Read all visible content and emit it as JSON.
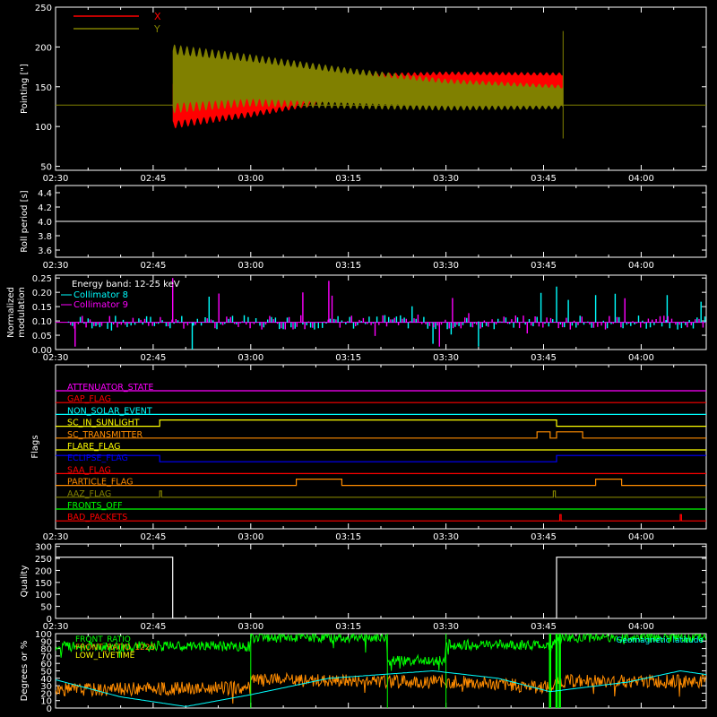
{
  "colors": {
    "background": "#000000",
    "axis": "#ffffff",
    "x_series": "#ff0000",
    "y_series": "#808000",
    "collimator_8": "#00ffff",
    "collimator_9": "#ff00ff",
    "front_ratio": "#00ff00",
    "orange": "#ff8c00",
    "blue": "#0000ff",
    "yellow": "#ffff00"
  },
  "chart_data": [
    {
      "id": "pointing",
      "type": "line",
      "ylabel": "Pointing [\"]",
      "ylim": [
        45,
        250
      ],
      "yticks": [
        50,
        100,
        150,
        200,
        250
      ],
      "xlim": [
        "02:30",
        "04:10"
      ],
      "xticks": [
        "02:30",
        "02:45",
        "03:00",
        "03:15",
        "03:30",
        "03:45",
        "04:00"
      ],
      "legend": {
        "position": "top-left",
        "entries": [
          "X",
          "Y"
        ]
      },
      "baseline": 127,
      "data_start": "02:48",
      "data_end": "03:48",
      "series": [
        {
          "name": "X",
          "color": "#ff0000",
          "center": [
            {
              "t": "02:48",
              "v": 130
            },
            {
              "t": "03:00",
              "v": 135
            },
            {
              "t": "03:15",
              "v": 150
            },
            {
              "t": "03:30",
              "v": 155
            },
            {
              "t": "03:48",
              "v": 155
            }
          ],
          "amplitude": [
            {
              "t": "02:48",
              "v": 28
            },
            {
              "t": "03:00",
              "v": 20
            },
            {
              "t": "03:15",
              "v": 14
            },
            {
              "t": "03:30",
              "v": 12
            },
            {
              "t": "03:48",
              "v": 11
            }
          ]
        },
        {
          "name": "Y",
          "color": "#808000",
          "center": [
            {
              "t": "02:48",
              "v": 160
            },
            {
              "t": "03:00",
              "v": 158
            },
            {
              "t": "03:15",
              "v": 148
            },
            {
              "t": "03:30",
              "v": 140
            },
            {
              "t": "03:48",
              "v": 137
            }
          ],
          "amplitude": [
            {
              "t": "02:48",
              "v": 37
            },
            {
              "t": "03:00",
              "v": 28
            },
            {
              "t": "03:15",
              "v": 22
            },
            {
              "t": "03:30",
              "v": 17
            },
            {
              "t": "03:48",
              "v": 13
            }
          ]
        }
      ]
    },
    {
      "id": "roll_period",
      "type": "line",
      "ylabel": "Roll period [s]",
      "ylim": [
        3.5,
        4.5
      ],
      "yticks": [
        "3.6",
        "3.8",
        "4.0",
        "4.2",
        "4.4"
      ],
      "xlim": [
        "02:30",
        "04:10"
      ],
      "xticks": [
        "02:30",
        "02:45",
        "03:00",
        "03:15",
        "03:30",
        "03:45",
        "04:00"
      ],
      "series": [
        {
          "name": "",
          "values": [
            {
              "t": "02:30",
              "v": 4.0
            },
            {
              "t": "04:10",
              "v": 4.0
            }
          ]
        }
      ]
    },
    {
      "id": "modulation",
      "type": "bar",
      "ylabel_lines": [
        "Normalized",
        "modulation"
      ],
      "ylim": [
        0,
        0.26
      ],
      "yticks": [
        "0.00",
        "0.05",
        "0.10",
        "0.15",
        "0.20",
        "0.25"
      ],
      "xlim": [
        "02:30",
        "04:10"
      ],
      "xticks": [
        "02:30",
        "02:45",
        "03:00",
        "03:15",
        "03:30",
        "03:45",
        "04:00"
      ],
      "annotation": "Energy band: 12-25 keV",
      "legend": {
        "position": "top-left",
        "entries": [
          "Collimator 8",
          "Collimator 9"
        ]
      },
      "baseline": 0.095,
      "series": [
        {
          "name": "Collimator 8",
          "color": "#00ffff",
          "peaks": [
            {
              "t": "03:47",
              "v": 0.22
            },
            {
              "t": "03:53",
              "v": 0.19
            },
            {
              "t": "04:04",
              "v": 0.19
            },
            {
              "t": "03:28",
              "v": 0.02
            },
            {
              "t": "03:35",
              "v": 0.01
            },
            {
              "t": "02:51",
              "v": 0.0
            }
          ]
        },
        {
          "name": "Collimator 9",
          "color": "#ff00ff",
          "peaks": [
            {
              "t": "02:48",
              "v": 0.25
            },
            {
              "t": "03:12",
              "v": 0.24
            },
            {
              "t": "03:08",
              "v": 0.2
            },
            {
              "t": "03:31",
              "v": 0.18
            },
            {
              "t": "03:29",
              "v": 0.01
            },
            {
              "t": "02:33",
              "v": 0.01
            }
          ]
        }
      ]
    },
    {
      "id": "flags",
      "type": "line",
      "ylabel": "Flags",
      "xlim": [
        "02:30",
        "04:10"
      ],
      "xticks": [
        "02:30",
        "02:45",
        "03:00",
        "03:15",
        "03:30",
        "03:45",
        "04:00"
      ],
      "flags": [
        {
          "name": "ATTENUATOR_STATE",
          "color": "#ff00ff",
          "high": []
        },
        {
          "name": "GAP_FLAG",
          "color": "#ff0000",
          "high": []
        },
        {
          "name": "NON_SOLAR_EVENT",
          "color": "#00ffff",
          "high": []
        },
        {
          "name": "SC_IN_SUNLIGHT",
          "color": "#ffff00",
          "high": [
            [
              "02:46",
              "03:47"
            ]
          ]
        },
        {
          "name": "SC_TRANSMITTER",
          "color": "#ff8c00",
          "high": [
            [
              "03:44",
              "03:46"
            ],
            [
              "03:47",
              "03:51"
            ]
          ]
        },
        {
          "name": "FLARE_FLAG",
          "color": "#ffff00",
          "high": []
        },
        {
          "name": "ECLIPSE_FLAG",
          "color": "#0000ff",
          "high": [
            [
              "02:30",
              "02:46"
            ],
            [
              "03:47",
              "04:10"
            ]
          ]
        },
        {
          "name": "SAA_FLAG",
          "color": "#ff0000",
          "high": []
        },
        {
          "name": "PARTICLE_FLAG",
          "color": "#ff8c00",
          "high": [
            [
              "03:07",
              "03:14"
            ],
            [
              "03:53",
              "03:57"
            ]
          ]
        },
        {
          "name": "AAZ_FLAG",
          "color": "#808000",
          "high": [
            [
              "02:46",
              "02:46.3"
            ],
            [
              "03:46.5",
              "03:46.8"
            ]
          ]
        },
        {
          "name": "FRONTS_OFF",
          "color": "#00ff00",
          "high": []
        },
        {
          "name": "BAD_PACKETS",
          "color": "#ff0000",
          "high": [
            [
              "03:47.5",
              "03:47.7"
            ],
            [
              "04:06",
              "04:06.2"
            ]
          ]
        }
      ]
    },
    {
      "id": "quality",
      "type": "line",
      "ylabel": "Quality",
      "ylim": [
        0,
        310
      ],
      "yticks": [
        0,
        50,
        100,
        150,
        200,
        250,
        300
      ],
      "xlim": [
        "02:30",
        "04:10"
      ],
      "xticks": [
        "02:30",
        "02:45",
        "03:00",
        "03:15",
        "03:30",
        "03:45",
        "04:00"
      ],
      "series": [
        {
          "name": "",
          "values": [
            {
              "t": "02:30",
              "v": 255
            },
            {
              "t": "02:48",
              "v": 255
            },
            {
              "t": "02:48",
              "v": 0
            },
            {
              "t": "03:47",
              "v": 0
            },
            {
              "t": "03:47",
              "v": 255
            },
            {
              "t": "04:10",
              "v": 255
            }
          ]
        }
      ]
    },
    {
      "id": "ratios",
      "type": "line",
      "ylabel": "Degrees or %",
      "ylim": [
        0,
        100
      ],
      "yticks": [
        0,
        10,
        20,
        30,
        40,
        50,
        60,
        70,
        80,
        90,
        100
      ],
      "xlim": [
        "02:30",
        "04:10"
      ],
      "xticks": [],
      "legend": {
        "position": "top-left",
        "entries": [
          "FRONT_RATIO",
          "FRONT_RATIO_1225",
          "LOW_LIVETIME"
        ]
      },
      "annotation": "Geomagnetic latitude",
      "series": [
        {
          "name": "FRONT_RATIO",
          "color": "#00ff00",
          "levels": [
            {
              "t": "02:30",
              "v": 83
            },
            {
              "t": "03:00",
              "v": 83
            },
            {
              "t": "03:00",
              "v": 95
            },
            {
              "t": "03:21",
              "v": 95
            },
            {
              "t": "03:21",
              "v": 63
            },
            {
              "t": "03:30",
              "v": 65
            },
            {
              "t": "03:30",
              "v": 85
            },
            {
              "t": "03:46",
              "v": 85
            },
            {
              "t": "03:48",
              "v": 95
            },
            {
              "t": "04:10",
              "v": 95
            }
          ]
        },
        {
          "name": "FRONT_RATIO_1225",
          "color": "#ff8c00",
          "levels": [
            {
              "t": "02:30",
              "v": 25
            },
            {
              "t": "03:00",
              "v": 27
            },
            {
              "t": "03:00",
              "v": 38
            },
            {
              "t": "03:21",
              "v": 36
            },
            {
              "t": "03:30",
              "v": 36
            },
            {
              "t": "03:46",
              "v": 28
            },
            {
              "t": "03:48",
              "v": 36
            },
            {
              "t": "04:10",
              "v": 36
            }
          ]
        },
        {
          "name": "LOW_LIVETIME",
          "color": "#ffff00",
          "levels": []
        },
        {
          "name": "Geomagnetic latitude",
          "color": "#00ffff",
          "points": [
            {
              "t": "02:30",
              "v": 38
            },
            {
              "t": "02:40",
              "v": 15
            },
            {
              "t": "02:50",
              "v": 2
            },
            {
              "t": "03:00",
              "v": 18
            },
            {
              "t": "03:12",
              "v": 40
            },
            {
              "t": "03:28",
              "v": 50
            },
            {
              "t": "03:38",
              "v": 40
            },
            {
              "t": "03:46",
              "v": 22
            },
            {
              "t": "03:58",
              "v": 35
            },
            {
              "t": "04:06",
              "v": 50
            },
            {
              "t": "04:10",
              "v": 45
            }
          ]
        }
      ]
    }
  ]
}
